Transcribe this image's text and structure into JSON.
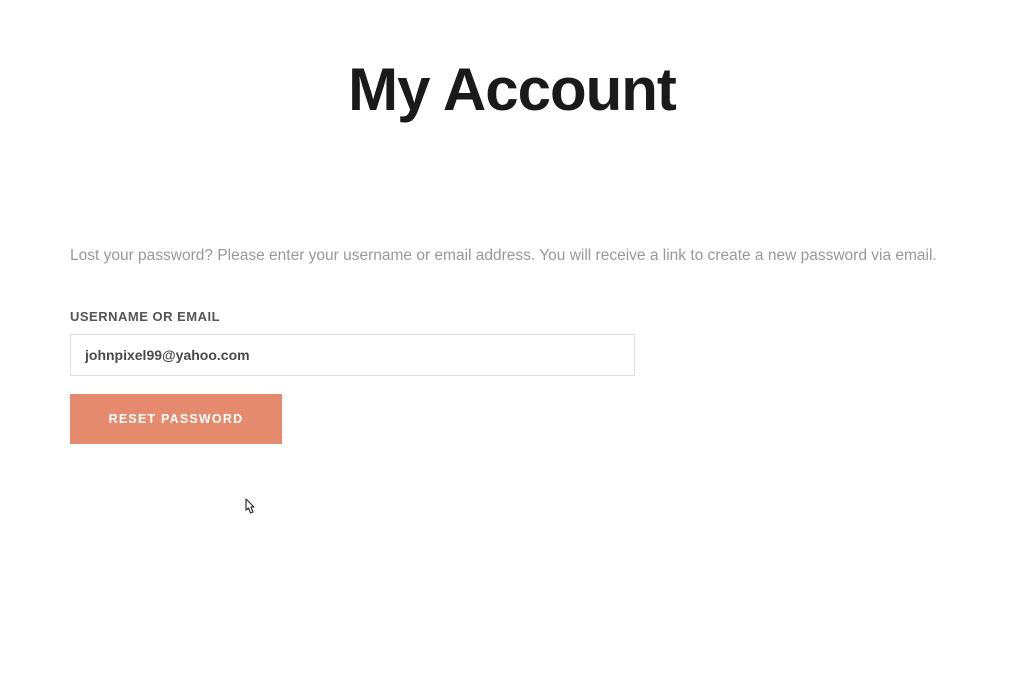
{
  "page": {
    "title": "My Account"
  },
  "form": {
    "instructions": "Lost your password? Please enter your username or email address. You will receive a link to create a new password via email.",
    "field_label": "USERNAME OR EMAIL",
    "input_value": "johnpixel99@yahoo.com",
    "button_label": "RESET PASSWORD"
  },
  "colors": {
    "accent": "#e68a6e"
  }
}
